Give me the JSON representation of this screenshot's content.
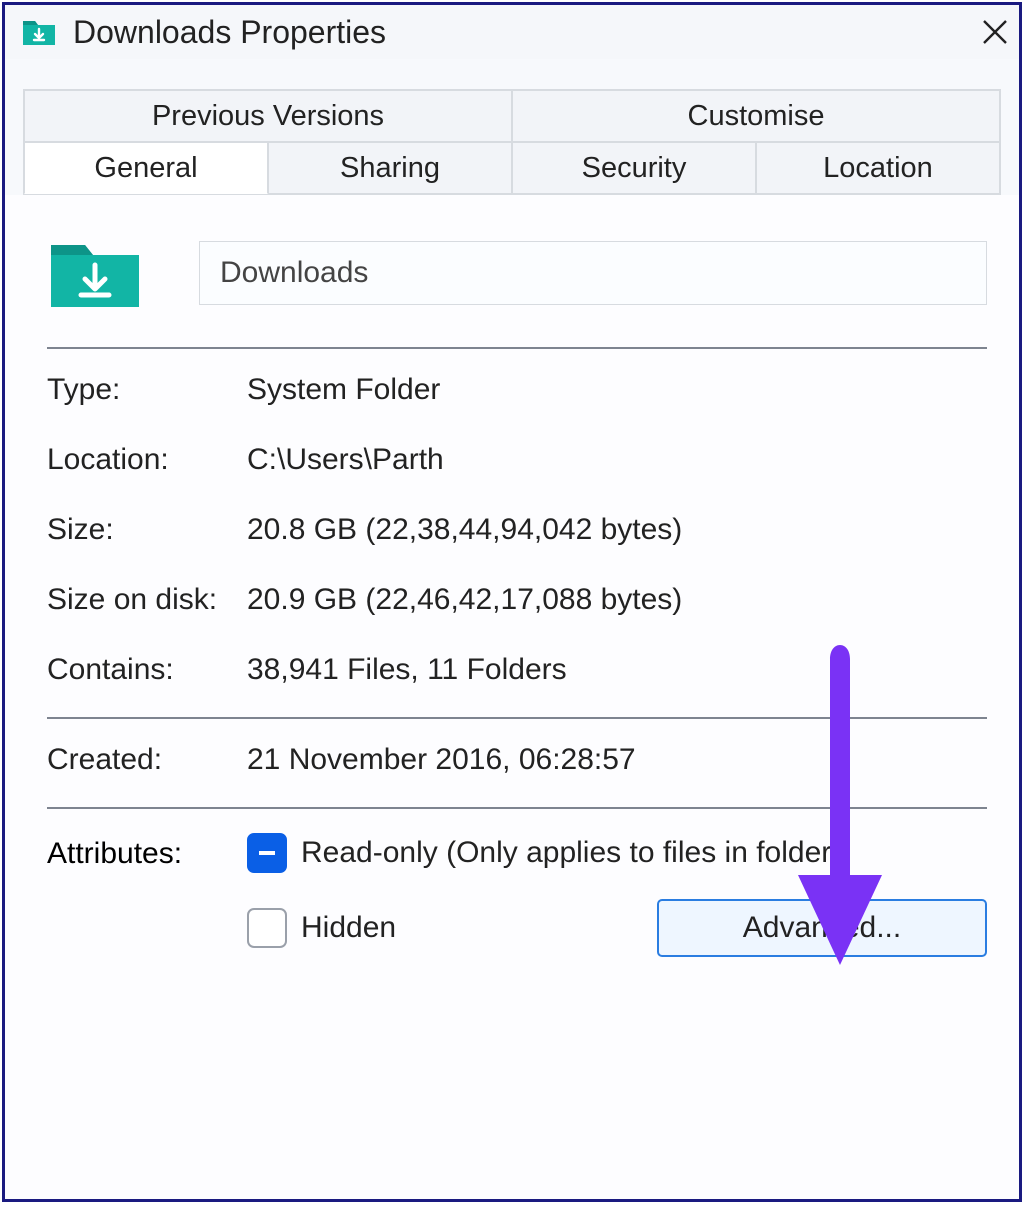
{
  "window": {
    "title": "Downloads Properties"
  },
  "tabs": {
    "row1": [
      "Previous Versions",
      "Customise"
    ],
    "row2": [
      "General",
      "Sharing",
      "Security",
      "Location"
    ],
    "active": "General"
  },
  "folder": {
    "name": "Downloads"
  },
  "info": {
    "type_label": "Type:",
    "type_value": "System Folder",
    "location_label": "Location:",
    "location_value": "C:\\Users\\Parth",
    "size_label": "Size:",
    "size_value": "20.8 GB (22,38,44,94,042 bytes)",
    "sizeondisk_label": "Size on disk:",
    "sizeondisk_value": "20.9 GB (22,46,42,17,088 bytes)",
    "contains_label": "Contains:",
    "contains_value": "38,941 Files, 11 Folders",
    "created_label": "Created:",
    "created_value": "21 November 2016, 06:28:57"
  },
  "attributes": {
    "label": "Attributes:",
    "readonly_label": "Read-only (Only applies to files in folder)",
    "hidden_label": "Hidden",
    "advanced_label": "Advanced..."
  },
  "colors": {
    "accent_teal": "#0fb2a2",
    "accent_blue": "#0a5fe6",
    "arrow": "#7a32f5"
  }
}
